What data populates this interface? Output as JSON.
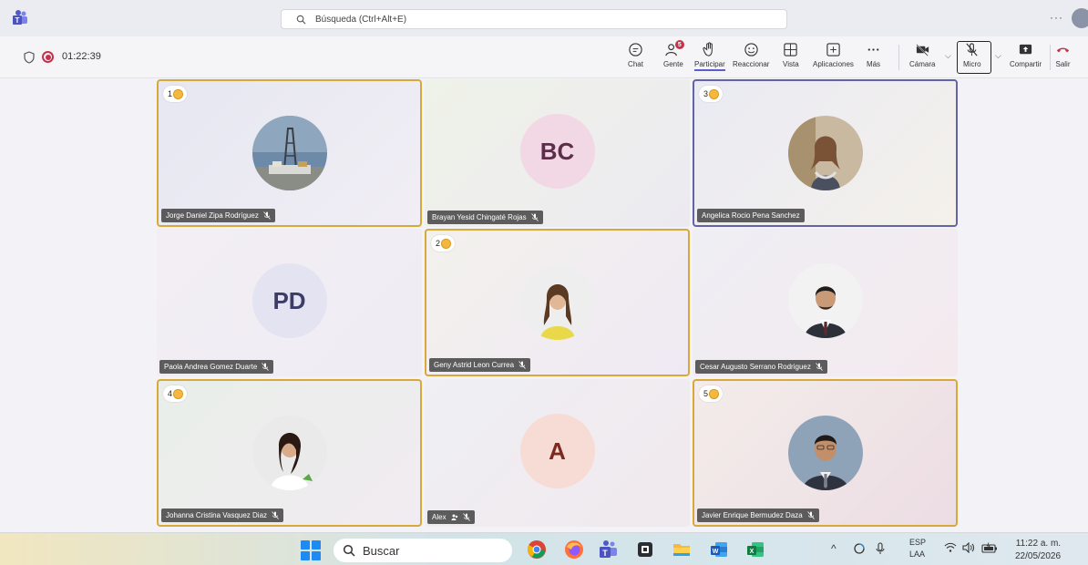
{
  "titlebar": {
    "search_placeholder": "Búsqueda (Ctrl+Alt+E)",
    "more": "···"
  },
  "meeting": {
    "timer": "01:22:39",
    "tools": {
      "chat": "Chat",
      "people": "Gente",
      "people_badge": "5",
      "participate": "Participar",
      "react": "Reaccionar",
      "view": "Vista",
      "apps": "Aplicaciones",
      "more": "Más",
      "camera": "Cámara",
      "mic": "Micro",
      "share": "Compartir",
      "leave": "Salir"
    },
    "more_dots": "···"
  },
  "participants": [
    {
      "name": "Jorge Daniel Zipa Rodríguez",
      "hand": "1",
      "initials": "",
      "muted": true
    },
    {
      "name": "Brayan Yesid Chingaté Rojas",
      "hand": "",
      "initials": "BC",
      "muted": true
    },
    {
      "name": "Angelica Rocio Pena Sanchez",
      "hand": "3",
      "initials": "",
      "muted": false
    },
    {
      "name": "Paola Andrea Gomez Duarte",
      "hand": "",
      "initials": "PD",
      "muted": true
    },
    {
      "name": "Geny Astrid Leon Currea",
      "hand": "2",
      "initials": "",
      "muted": true
    },
    {
      "name": "Cesar Augusto Serrano Rodriguez",
      "hand": "",
      "initials": "",
      "muted": true
    },
    {
      "name": "Johanna Cristina Vasquez Diaz",
      "hand": "4",
      "initials": "",
      "muted": true
    },
    {
      "name": "Alex",
      "hand": "",
      "initials": "A",
      "muted": true
    },
    {
      "name": "Javier Enrique Bermudez Daza",
      "hand": "5",
      "initials": "",
      "muted": true
    }
  ],
  "colors": {
    "hand_border": "#d8a93a",
    "active_border": "#6264a7",
    "accent": "#5b5fc7"
  },
  "taskbar": {
    "search": "Buscar",
    "tray_chevron": "^",
    "lang_1": "ESP",
    "lang_2": "LAA",
    "time": "11:22 a. m.",
    "date": "22/05/2026"
  }
}
